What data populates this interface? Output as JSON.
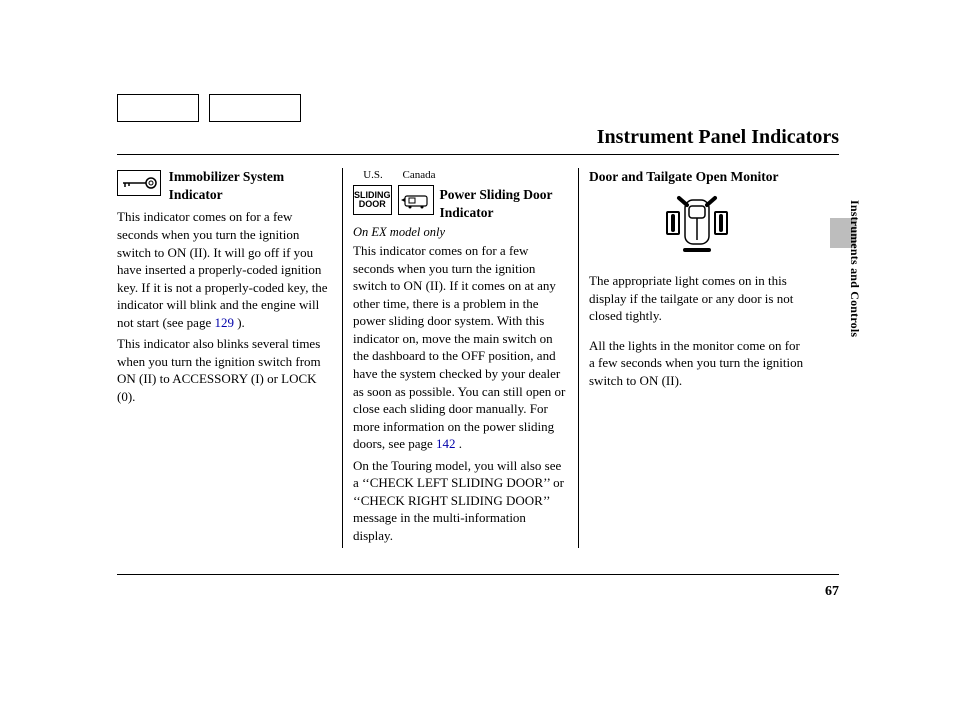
{
  "page_title": "Instrument Panel Indicators",
  "section_label": "Instruments and Controls",
  "page_number": "67",
  "col1": {
    "heading": "Immobilizer System Indicator",
    "p1a": "This indicator comes on for a few seconds when you turn the ignition switch to ON (II). It will go off if you have inserted a properly-coded ignition key. If it is not a properly-coded key, the indicator will blink and the engine will not start (see page ",
    "link1": "129",
    "p1b": " ).",
    "p2": "This indicator also blinks several times when you turn the ignition switch from ON (II) to ACCESSORY (I) or LOCK (0)."
  },
  "col2": {
    "label_us": "U.S.",
    "label_ca": "Canada",
    "icon_text": "SLIDING\nDOOR",
    "heading": "Power Sliding Door Indicator",
    "subnote": "On EX model only",
    "p1a": "This indicator comes on for a few seconds when you turn the ignition switch to ON (II). If it comes on at any other time, there is a problem in the power sliding door system. With this indicator on, move the main switch on the dashboard to the OFF position, and have the system checked by your dealer as soon as possible. You can still open or close each sliding door manually. For more information on the power sliding doors, see page ",
    "link1": "142",
    "p1b": " .",
    "p2": "On the Touring model, you will also see a ‘‘CHECK LEFT SLIDING DOOR’’ or ‘‘CHECK RIGHT SLIDING DOOR’’ message in the multi-information display."
  },
  "col3": {
    "heading": "Door and Tailgate Open Monitor",
    "p1": "The appropriate light comes on in this display if the tailgate or any door is not closed tightly.",
    "p2": "All the lights in the monitor come on for a few seconds when you turn the ignition switch to ON (II)."
  }
}
